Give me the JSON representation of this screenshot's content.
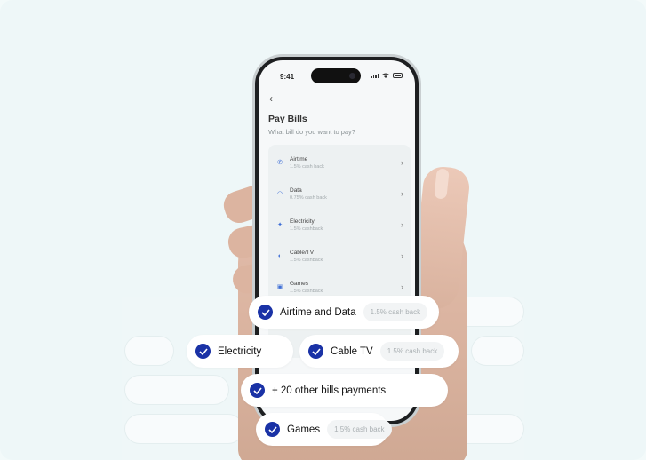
{
  "phone": {
    "status_time": "9:41",
    "back_icon": "chevron-left-icon",
    "title": "Pay Bills",
    "subtitle": "What bill do you want to pay?",
    "bills": [
      {
        "label": "Airtime",
        "sub": "1.5% cash back",
        "icon": "phone-icon"
      },
      {
        "label": "Data",
        "sub": "0.75% cash back",
        "icon": "wifi-icon"
      },
      {
        "label": "Electricity",
        "sub": "1.5% cashback",
        "icon": "bulb-icon"
      },
      {
        "label": "Cable/TV",
        "sub": "1.5% cashback",
        "icon": "satellite-icon"
      },
      {
        "label": "Games",
        "sub": "1.5% cashback",
        "icon": "gamepad-icon"
      }
    ]
  },
  "features": {
    "airtime_data": {
      "label": "Airtime and Data",
      "tag": "1.5% cash back"
    },
    "electricity": {
      "label": "Electricity"
    },
    "cable_tv": {
      "label": "Cable TV",
      "tag": "1.5% cash back"
    },
    "other_bills": {
      "label": "+ 20 other bills payments"
    },
    "games": {
      "label": "Games",
      "tag": "1.5% cash back"
    }
  },
  "colors": {
    "accent": "#1a32a6",
    "background": "#eef7f8"
  }
}
